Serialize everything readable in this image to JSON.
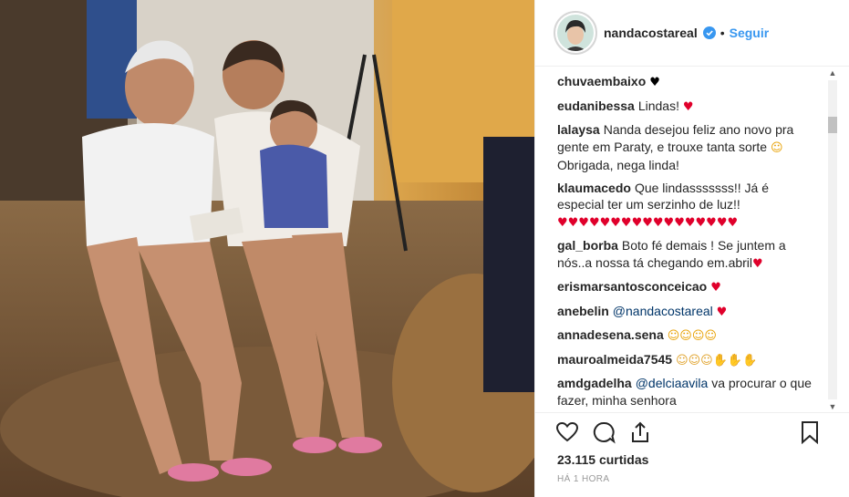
{
  "post": {
    "username": "nandacostareal",
    "separator": "•",
    "follow_label": "Seguir",
    "likes": "23.115 curtidas",
    "timestamp": "HÁ 1 HORA"
  },
  "icons": {
    "like": "heart-outline-icon",
    "comment": "comment-bubble-icon",
    "share": "share-icon",
    "save": "bookmark-icon",
    "verified": "verified-badge-icon"
  },
  "colors": {
    "link": "#3897f0",
    "mention": "#003569",
    "heart": "#e0002b"
  },
  "comments": [
    {
      "user": "chuvaembaixo",
      "text": "",
      "emoji": "♥"
    },
    {
      "user": "eudanibessa",
      "text": "Lindas!",
      "emoji": "♥"
    },
    {
      "user": "lalaysa",
      "text": "Nanda desejou feliz ano novo pra gente em Paraty, e trouxe tanta sorte",
      "emoji": "☺",
      "text2": "Obrigada, nega linda!"
    },
    {
      "user": "klaumacedo",
      "text": "Que lindasssssss!! Já é especial ter um serzinho de luz!!",
      "emoji": "♥♥♥♥♥♥♥♥♥♥♥♥♥♥♥♥♥"
    },
    {
      "user": "gal_borba",
      "text": "Boto fé demais ! Se juntem a nós..a nossa tá chegando em.abril",
      "emoji": "♥"
    },
    {
      "user": "erismarsantosconceicao",
      "text": "",
      "emoji": "♥"
    },
    {
      "user": "anebelin",
      "mention": "@nandacostareal",
      "text": "",
      "emoji": "♥"
    },
    {
      "user": "annadesena.sena",
      "text": "",
      "emoji": "☺☺☺☺"
    },
    {
      "user": "mauroalmeida7545",
      "text": "",
      "emoji": "☺☺☺✋✋✋"
    },
    {
      "user": "amdgadelha",
      "mention": "@delciaavila",
      "text": "va procurar o que fazer, minha senhora",
      "emoji": ""
    }
  ]
}
